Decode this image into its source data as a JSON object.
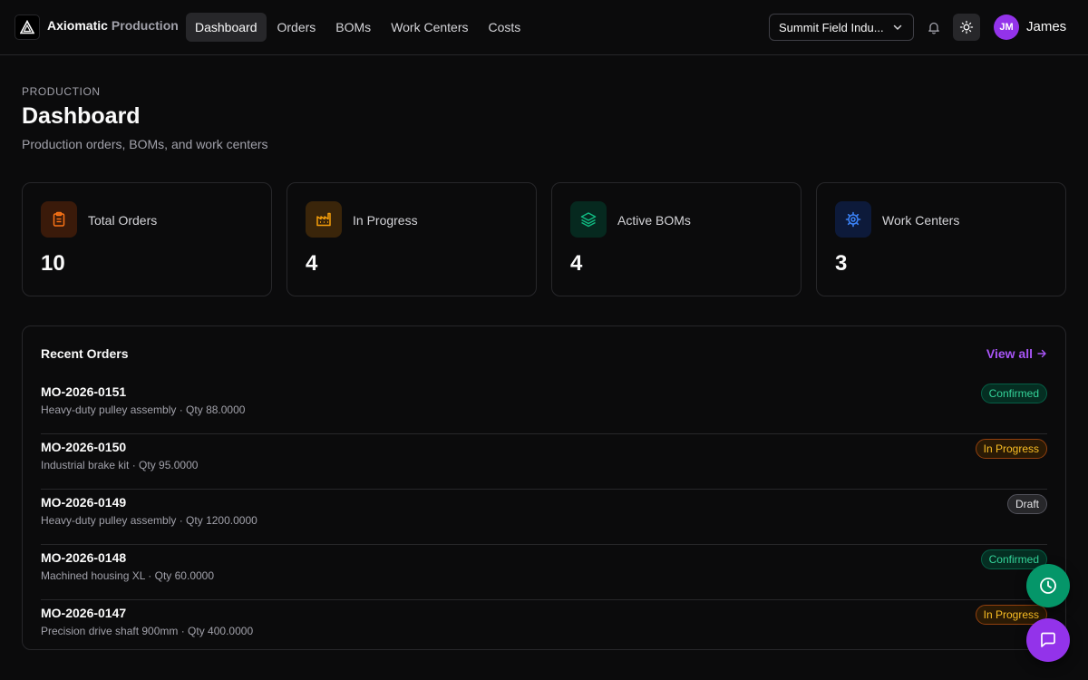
{
  "app": {
    "brand_primary": "Axiomatic",
    "brand_secondary": "Production"
  },
  "nav": [
    "Dashboard",
    "Orders",
    "BOMs",
    "Work Centers",
    "Costs"
  ],
  "org_selector": {
    "value": "Summit Field Indu..."
  },
  "user": {
    "initials": "JM",
    "name": "James",
    "avatar_color": "#9333ea"
  },
  "header": {
    "eyebrow": "PRODUCTION",
    "title": "Dashboard",
    "subtitle": "Production orders, BOMs, and work centers"
  },
  "stats": [
    {
      "label": "Total Orders",
      "value": "10",
      "icon": "clipboard-icon",
      "color": "#f97316"
    },
    {
      "label": "In Progress",
      "value": "4",
      "icon": "factory-icon",
      "color": "#f59e0b"
    },
    {
      "label": "Active BOMs",
      "value": "4",
      "icon": "layers-icon",
      "color": "#10b981"
    },
    {
      "label": "Work Centers",
      "value": "3",
      "icon": "cog-icon",
      "color": "#3b82f6"
    }
  ],
  "recent_orders": {
    "title": "Recent Orders",
    "view_all": "View all",
    "rows": [
      {
        "id": "MO-2026-0151",
        "meta": "Heavy-duty pulley assembly · Qty 88.0000",
        "status": "Confirmed"
      },
      {
        "id": "MO-2026-0150",
        "meta": "Industrial brake kit · Qty 95.0000",
        "status": "In Progress"
      },
      {
        "id": "MO-2026-0149",
        "meta": "Heavy-duty pulley assembly · Qty 1200.0000",
        "status": "Draft"
      },
      {
        "id": "MO-2026-0148",
        "meta": "Machined housing XL · Qty 60.0000",
        "status": "Confirmed"
      },
      {
        "id": "MO-2026-0147",
        "meta": "Precision drive shaft 900mm · Qty 400.0000",
        "status": "In Progress"
      }
    ]
  },
  "colors": {
    "accent": "#a855f7",
    "confirmed": "#34d399",
    "in_progress": "#fbbf24",
    "draft": "#e4e4e7"
  }
}
